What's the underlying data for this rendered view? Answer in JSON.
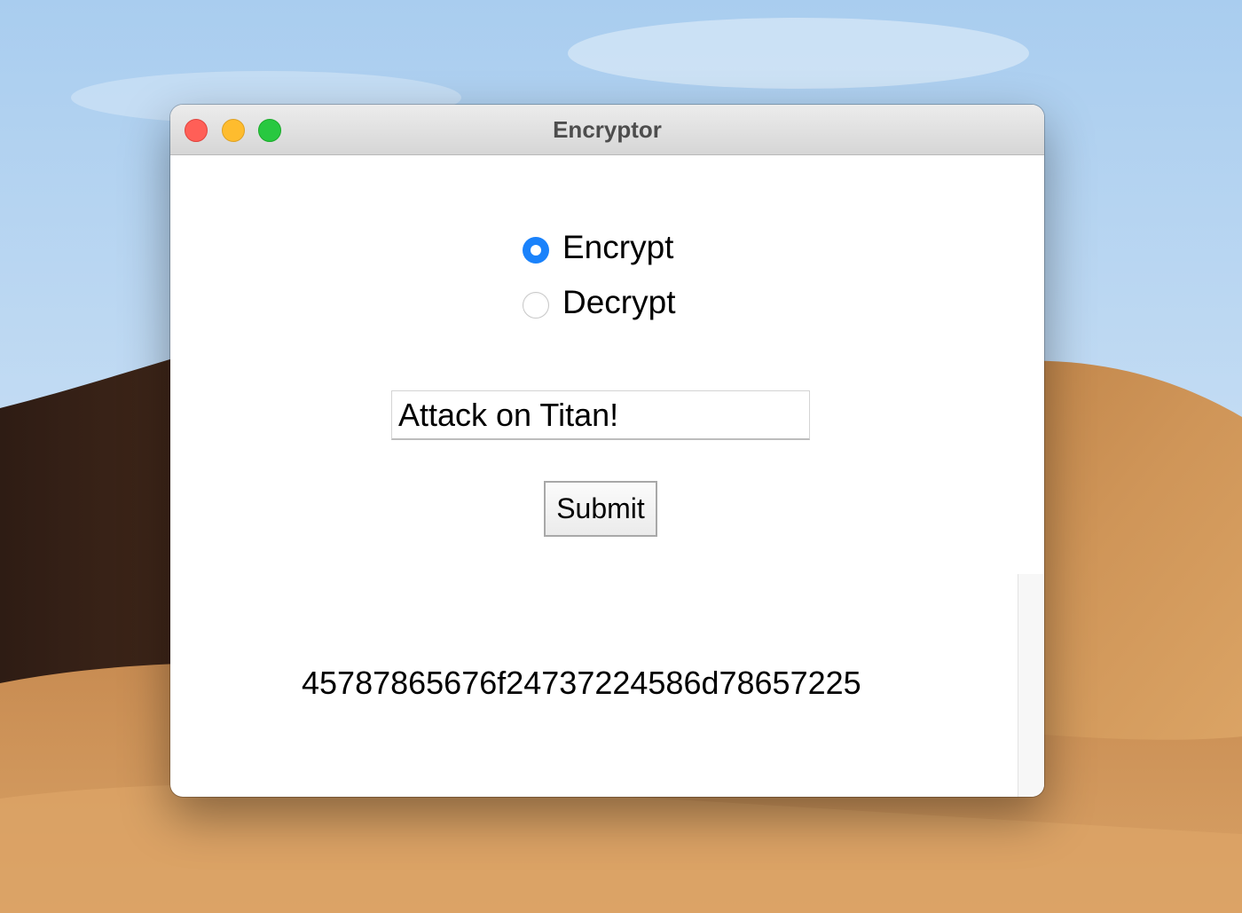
{
  "window": {
    "title": "Encryptor"
  },
  "mode": {
    "selected": "Encrypt",
    "options": [
      {
        "label": "Encrypt",
        "selected": true
      },
      {
        "label": "Decrypt",
        "selected": false
      }
    ]
  },
  "input": {
    "value": "Attack on Titan!"
  },
  "submit": {
    "label": "Submit"
  },
  "output": {
    "text": "45787865676f24737224586d78657225"
  },
  "colors": {
    "accent": "#1a82fb",
    "close": "#ff5f57",
    "minimize": "#febc2e",
    "zoom": "#28c840"
  }
}
